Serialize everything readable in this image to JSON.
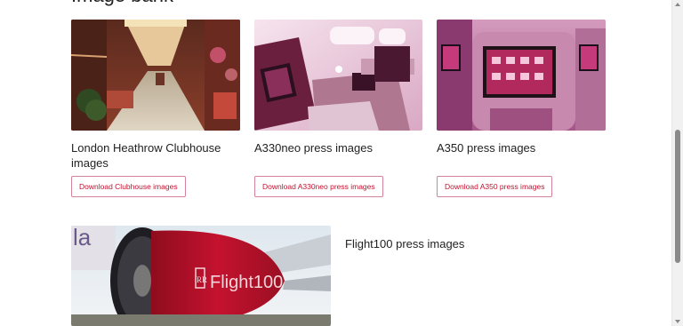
{
  "section": {
    "title": "Image bank"
  },
  "cards": [
    {
      "title": "London Heathrow Clubhouse images",
      "button": "Download Clubhouse images"
    },
    {
      "title": "A330neo press images",
      "button": "Download A330neo press images"
    },
    {
      "title": "A350 press images",
      "button": "Download A350 press images"
    },
    {
      "title": "Flight100 press images"
    }
  ],
  "images": {
    "clubhouse": "clubhouse-interior-photo",
    "a330neo": "a330neo-suite-photo",
    "a350": "a350-seatback-screens-photo",
    "flight100": "flight100-engine-photo"
  },
  "engine_lettering": {
    "logo": "RR",
    "text": "Flight100"
  },
  "colors": {
    "accent": "#c4122f",
    "button_border": "#d4849a"
  }
}
